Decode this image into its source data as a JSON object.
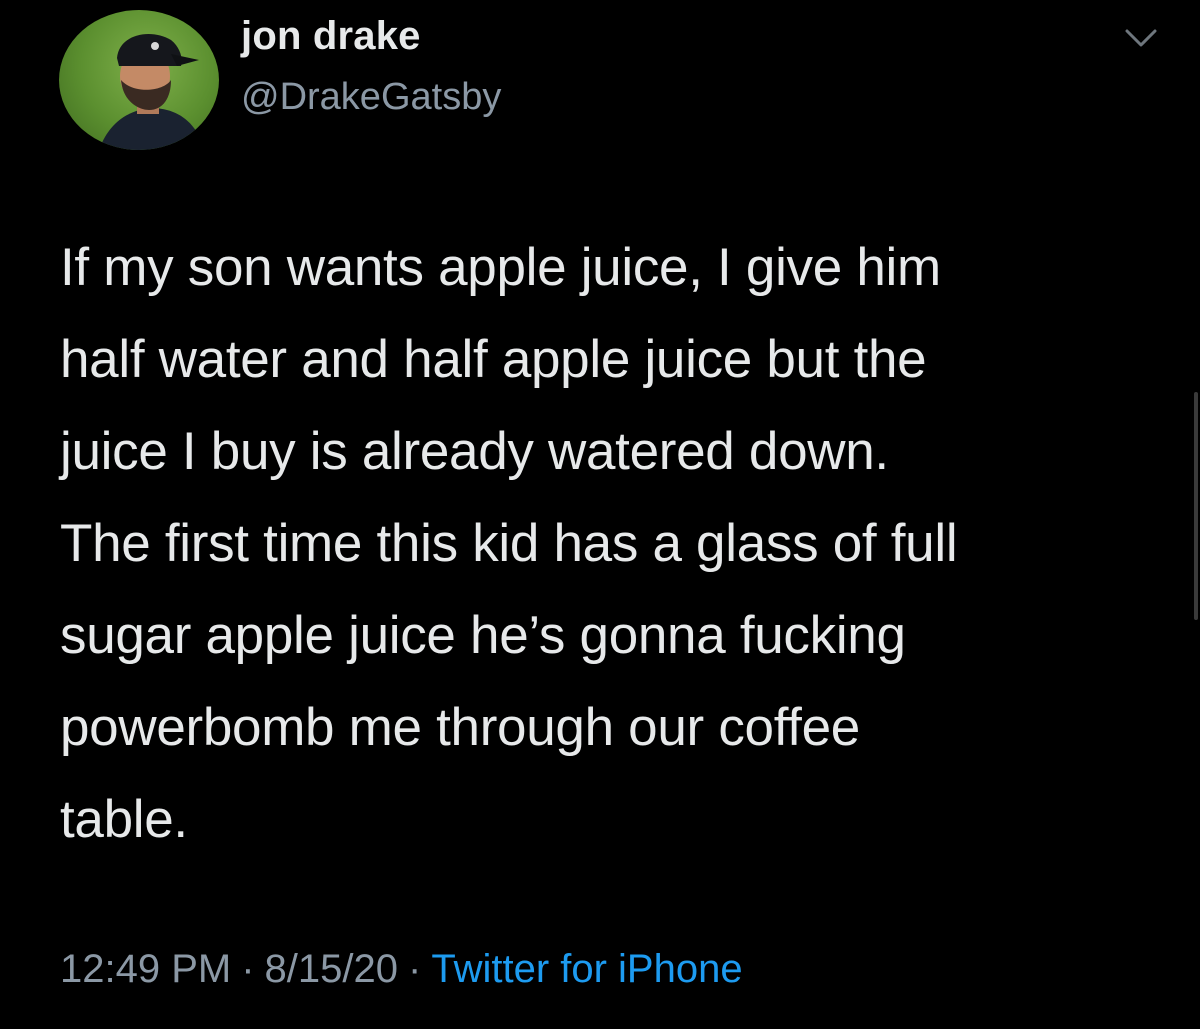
{
  "tweet": {
    "author": {
      "name": "jon drake",
      "handle": "@DrakeGatsby"
    },
    "text": "If my son wants apple juice, I give him\nhalf water and half apple juice but the\njuice I buy is already watered down.\nThe first time this kid has a glass of full\nsugar apple juice he’s gonna fucking\npowerbomb me through our coffee\ntable.",
    "time": "12:49 PM",
    "separator": "·",
    "date": "8/15/20",
    "source": "Twitter for iPhone"
  },
  "icons": {
    "menu": "chevron-down-icon"
  },
  "colors": {
    "background": "#000000",
    "text": "#e7e9ea",
    "secondary": "#8b98a5",
    "link": "#1d9bf0"
  }
}
